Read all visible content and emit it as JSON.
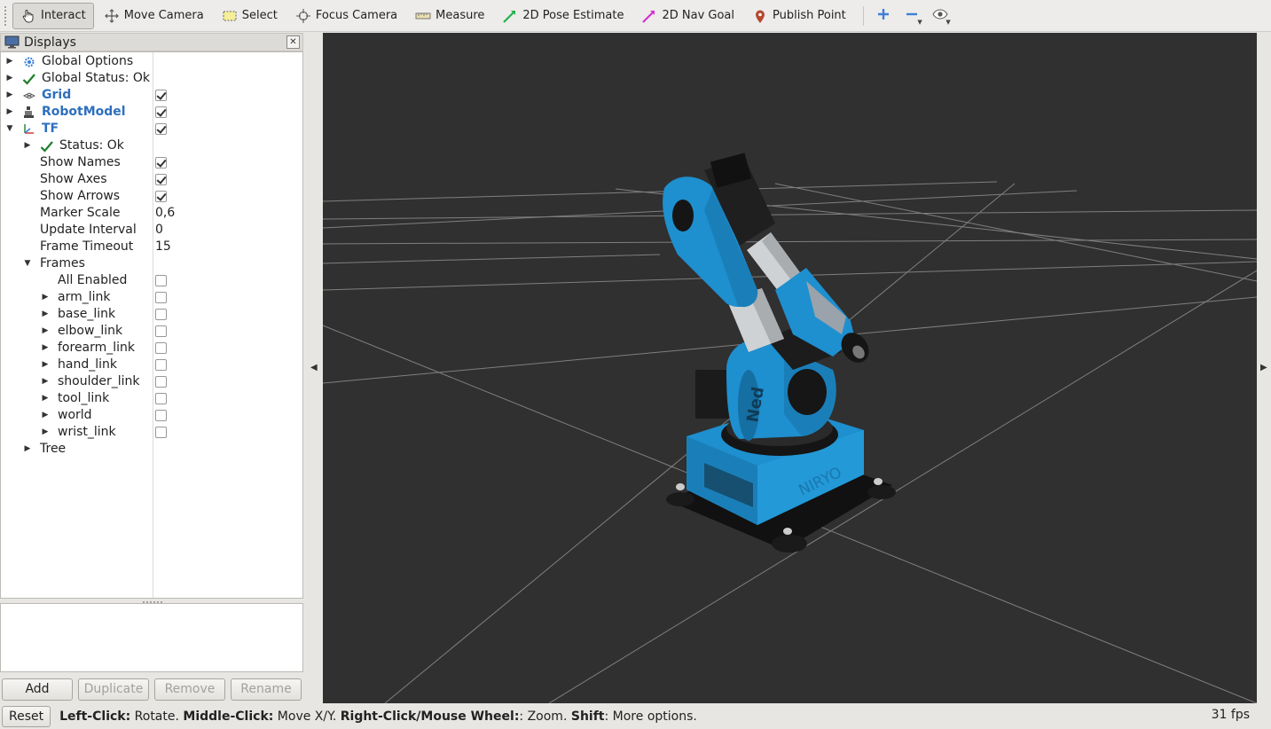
{
  "toolbar": {
    "tools": [
      {
        "label": "Interact",
        "icon": "hand-pointer-icon",
        "active": true
      },
      {
        "label": "Move Camera",
        "icon": "move-arrows-icon",
        "active": false
      },
      {
        "label": "Select",
        "icon": "select-rectangle-icon",
        "active": false
      },
      {
        "label": "Focus Camera",
        "icon": "focus-target-icon",
        "active": false
      },
      {
        "label": "Measure",
        "icon": "ruler-icon",
        "active": false
      },
      {
        "label": "2D Pose Estimate",
        "icon": "green-arrow-icon",
        "active": false
      },
      {
        "label": "2D Nav Goal",
        "icon": "magenta-arrow-icon",
        "active": false
      },
      {
        "label": "Publish Point",
        "icon": "map-pin-icon",
        "active": false
      }
    ],
    "colors": {
      "pose": "#22b14c",
      "nav": "#d62fd1",
      "pin": "#b5482f",
      "plus": "#3d7fd6"
    }
  },
  "displays": {
    "title": "Displays",
    "close_glyph": "✕",
    "rows": [
      {
        "label": "Global Options"
      },
      {
        "label": "Global Status: Ok"
      },
      {
        "label": "Grid"
      },
      {
        "label": "RobotModel"
      },
      {
        "label": "TF"
      },
      {
        "label": "Status: Ok"
      },
      {
        "label": "Show Names"
      },
      {
        "label": "Show Axes"
      },
      {
        "label": "Show Arrows"
      },
      {
        "label": "Marker Scale",
        "value": "0,6"
      },
      {
        "label": "Update Interval",
        "value": "0"
      },
      {
        "label": "Frame Timeout",
        "value": "15"
      },
      {
        "label": "Frames"
      },
      {
        "label": "All Enabled"
      },
      {
        "label": "arm_link"
      },
      {
        "label": "base_link"
      },
      {
        "label": "elbow_link"
      },
      {
        "label": "forearm_link"
      },
      {
        "label": "hand_link"
      },
      {
        "label": "shoulder_link"
      },
      {
        "label": "tool_link"
      },
      {
        "label": "world"
      },
      {
        "label": "wrist_link"
      },
      {
        "label": "Tree"
      }
    ],
    "buttons": {
      "add": "Add",
      "duplicate": "Duplicate",
      "remove": "Remove",
      "rename": "Rename"
    }
  },
  "robot": {
    "brand_text": "Ned",
    "base_text": "NIRYO",
    "body_color": "#1e8fcf",
    "dark_color": "#1c1c1c"
  },
  "status": {
    "reset": "Reset",
    "hint_parts": [
      {
        "bold": "Left-Click:",
        "text": " Rotate. "
      },
      {
        "bold": "Middle-Click:",
        "text": " Move X/Y. "
      },
      {
        "bold": "Right-Click/Mouse Wheel:",
        "text": ": Zoom. "
      },
      {
        "bold": "Shift",
        "text": ": More options."
      }
    ],
    "fps": "31 fps"
  }
}
